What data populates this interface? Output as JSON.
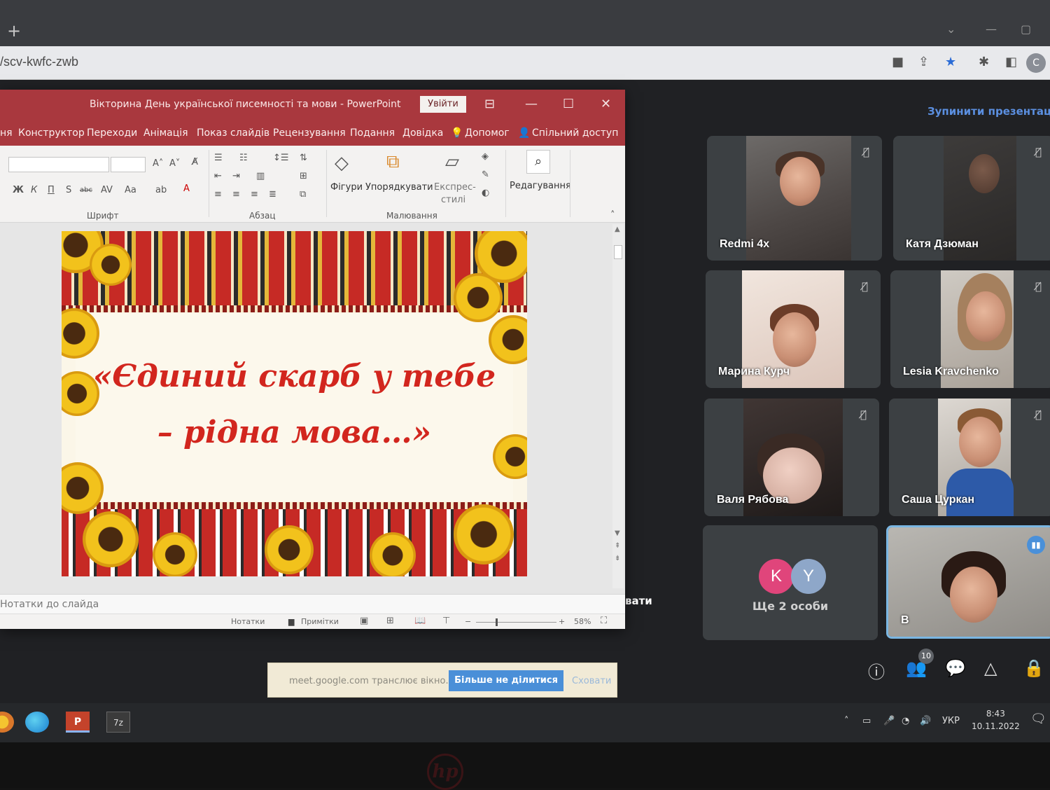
{
  "browser": {
    "new_tab": "+",
    "url": "/scv-kwfc-zwb",
    "profile_initial": "C"
  },
  "meet": {
    "stop_presenting": "Зупинити презентацію",
    "participants": [
      {
        "name": "Redmi 4x"
      },
      {
        "name": "Катя Дзюман"
      },
      {
        "name": "Марина Курч"
      },
      {
        "name": "Lesia Kravchenko"
      },
      {
        "name": "Валя Рябова"
      },
      {
        "name": "Саша Цуркан"
      }
    ],
    "more_people": {
      "initials": [
        "K",
        "Y"
      ],
      "label": "Ще 2 особи"
    },
    "self_name": "В",
    "participant_count": "10",
    "side_text": "вати",
    "share_bar": {
      "message": "meet.google.com транслює вікно.",
      "stop_button": "Більше не ділитися",
      "hide_button": "Сховати"
    }
  },
  "powerpoint": {
    "title": "Вікторина День української писемності та мови  -  PowerPoint",
    "sign_in": "Увійти",
    "tabs": [
      "ня",
      "Конструктор",
      "Переходи",
      "Анімація",
      "Показ слайдів",
      "Рецензування",
      "Подання",
      "Довідка",
      "Допомог",
      "Спільний доступ"
    ],
    "ribbon": {
      "font_group": "Шрифт",
      "paragraph_group": "Абзац",
      "drawing_group": "Малювання",
      "shapes": "Фігури",
      "arrange": "Упорядкувати",
      "quick_styles": "Експрес-\nстилі",
      "quick_styles_line1": "Експрес-",
      "quick_styles_line2": "стилі",
      "editing": "Редагування"
    },
    "slide": {
      "line1": "«Єдиний скарб у тебе",
      "line2": "– рідна мова…»"
    },
    "notes_placeholder": "Нотатки до слайда",
    "status": {
      "notes": "Нотатки",
      "comments": "Примітки",
      "zoom": "58%"
    }
  },
  "taskbar": {
    "language": "УКР",
    "time": "8:43",
    "date": "10.11.2022"
  },
  "colors": {
    "ppt_accent": "#a9383e",
    "meet_bg": "#202124",
    "slide_text": "#d2261e",
    "share_button": "#4a8fd8"
  }
}
